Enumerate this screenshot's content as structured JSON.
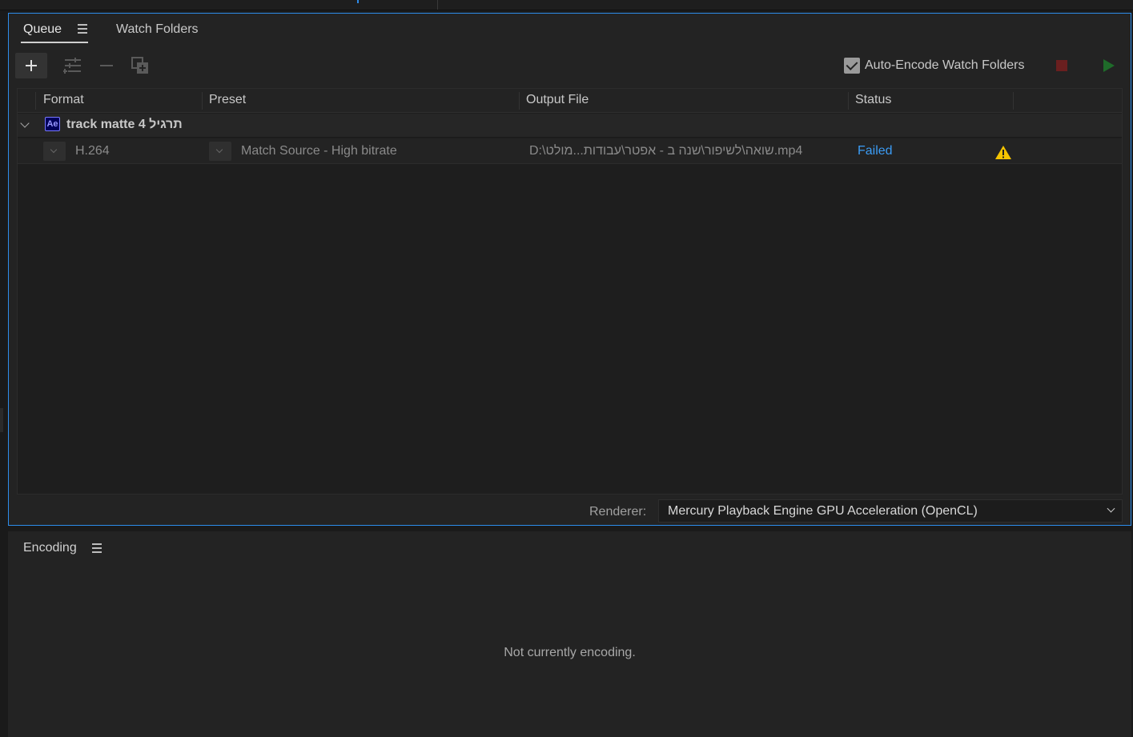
{
  "queue_panel": {
    "tabs": [
      {
        "label": "Queue",
        "active": true
      },
      {
        "label": "Watch Folders",
        "active": false
      }
    ],
    "toolbar": {
      "add_icon": "plus-icon",
      "settings_icon": "settings-sliders-icon",
      "remove_icon": "minus-icon",
      "duplicate_icon": "duplicate-icon",
      "auto_encode_label": "Auto-Encode Watch Folders",
      "auto_encode_checked": true,
      "stop_icon": "stop-icon",
      "start_icon": "play-icon"
    },
    "columns": [
      "Format",
      "Preset",
      "Output File",
      "Status"
    ],
    "group": {
      "app_badge": "Ae",
      "name": "track matte 4 תרגיל"
    },
    "items": [
      {
        "format": "H.264",
        "preset": "Match Source - High bitrate",
        "output_file": "D:\\שואה\\לשיפור\\שנה ב - אפטר\\עבודות...מולט.mp4",
        "status": "Failed",
        "status_icon": "warning-icon"
      }
    ],
    "renderer": {
      "label": "Renderer:",
      "value": "Mercury Playback Engine GPU Acceleration (OpenCL)"
    }
  },
  "encoding_panel": {
    "title": "Encoding",
    "status_text": "Not currently encoding."
  },
  "colors": {
    "accent": "#2d8ceb",
    "failed_link": "#3b9cf5",
    "warning": "#f5c400",
    "stop": "#6a1f1f",
    "play": "#1f6b2a"
  }
}
